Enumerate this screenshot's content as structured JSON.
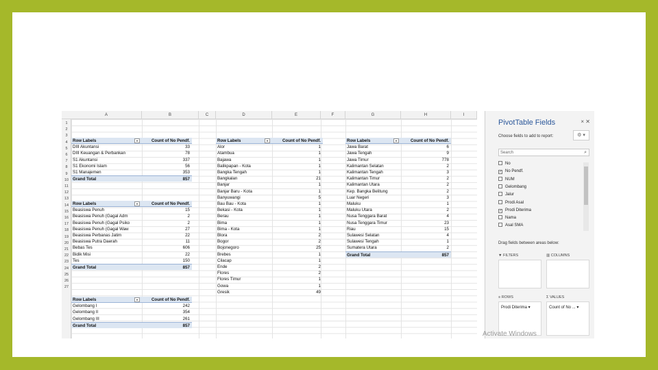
{
  "sheet": {
    "columns": [
      "A",
      "B",
      "C",
      "D",
      "E",
      "F",
      "G",
      "H",
      "I"
    ],
    "rows": [
      "1",
      "2",
      "3",
      "4",
      "5",
      "6",
      "7",
      "8",
      "9",
      "10",
      "11",
      "12",
      "13",
      "14",
      "15",
      "16",
      "17",
      "18",
      "19",
      "20",
      "21",
      "22",
      "23",
      "24",
      "25",
      "26",
      "27"
    ]
  },
  "pivot1": {
    "header": [
      "Row Labels",
      "Count of No Pendf."
    ],
    "rows": [
      [
        "DIII Akuntansi",
        "33"
      ],
      [
        "DIII Keuangan & Perbankan",
        "78"
      ],
      [
        "S1 Akuntansi",
        "337"
      ],
      [
        "S1 Ekonomi Islam",
        "56"
      ],
      [
        "S1 Manajemen",
        "353"
      ]
    ],
    "total": [
      "Grand Total",
      "857"
    ]
  },
  "pivot2": {
    "header": [
      "Row Labels",
      "Count of No Pendf."
    ],
    "rows": [
      [
        "Beasiswa Penuh",
        "15"
      ],
      [
        "Beasiswa Penuh (Gagal Adm",
        "2"
      ],
      [
        "Beasiswa Penuh (Gagal Psiko",
        "2"
      ],
      [
        "Beasiswa Penuh (Gagal Waw",
        "27"
      ],
      [
        "Beasiswa Perbanas Jatim",
        "22"
      ],
      [
        "Beasiswa Putra Daerah",
        "11"
      ],
      [
        "Bebas Tes",
        "606"
      ],
      [
        "Bidik Misi",
        "22"
      ],
      [
        "Tes",
        "150"
      ]
    ],
    "total": [
      "Grand Total",
      "857"
    ]
  },
  "pivot3": {
    "header": [
      "Row Labels",
      "Count of No Pendf."
    ],
    "rows": [
      [
        "Gelombang I",
        "242"
      ],
      [
        "Gelombang II",
        "354"
      ],
      [
        "Gelombang III",
        "261"
      ]
    ],
    "total": [
      "Grand Total",
      "857"
    ]
  },
  "pivot4": {
    "header": [
      "Row Labels",
      "Count of No Pendf."
    ],
    "rows": [
      [
        "Alor",
        "1"
      ],
      [
        "Atambua",
        "1"
      ],
      [
        "Bajawa",
        "1"
      ],
      [
        "Balikpapan - Kota",
        "1"
      ],
      [
        "Bangka Tengah",
        "1"
      ],
      [
        "Bangkalan",
        "21"
      ],
      [
        "Banjar",
        "1"
      ],
      [
        "Banjar Baru - Kota",
        "1"
      ],
      [
        "Banyuwangi",
        "5"
      ],
      [
        "Bau Bau - Kota",
        "1"
      ],
      [
        "Bekasi - Kota",
        "1"
      ],
      [
        "Berau",
        "1"
      ],
      [
        "Bima",
        "1"
      ],
      [
        "Bima - Kota",
        "1"
      ],
      [
        "Blora",
        "2"
      ],
      [
        "Bogor",
        "2"
      ],
      [
        "Bojonegoro",
        "25"
      ],
      [
        "Brebes",
        "1"
      ],
      [
        "Cilacap",
        "1"
      ],
      [
        "Ende",
        "2"
      ],
      [
        "Flores",
        "2"
      ],
      [
        "Flores Timur",
        "1"
      ],
      [
        "Gowa",
        "1"
      ],
      [
        "Gresik",
        "49"
      ]
    ]
  },
  "pivot5": {
    "header": [
      "Row Labels",
      "Count of No Pendf."
    ],
    "rows": [
      [
        "Jawa Barat",
        "6"
      ],
      [
        "Jawa Tengah",
        "9"
      ],
      [
        "Jawa Timur",
        "778"
      ],
      [
        "Kalimantan Selatan",
        "2"
      ],
      [
        "Kalimantan Tengah",
        "3"
      ],
      [
        "Kalimantan Timur",
        "2"
      ],
      [
        "Kalimantan Utara",
        "2"
      ],
      [
        "Kep. Bangka Belitung",
        "2"
      ],
      [
        "Luar Negeri",
        "3"
      ],
      [
        "Maluku",
        "1"
      ],
      [
        "Maluku Utara",
        "2"
      ],
      [
        "Nusa Tenggara Barat",
        "4"
      ],
      [
        "Nusa Tenggara Timur",
        "23"
      ],
      [
        "Riau",
        "15"
      ],
      [
        "Sulawesi Selatan",
        "4"
      ],
      [
        "Sulawesi Tengah",
        "1"
      ],
      [
        "Sumatera Utara",
        "2"
      ]
    ],
    "total": [
      "Grand Total",
      "857"
    ]
  },
  "pane": {
    "title": "PivotTable Fields",
    "close": "× ✕",
    "subtitle": "Choose fields to add to report:",
    "gear": "⚙ ▾",
    "search_placeholder": "Search",
    "fields": [
      {
        "label": "No",
        "checked": false
      },
      {
        "label": "No Pendf.",
        "checked": true
      },
      {
        "label": "NUM",
        "checked": false
      },
      {
        "label": "Gelombang",
        "checked": false
      },
      {
        "label": "Jalur",
        "checked": false
      },
      {
        "label": "Prodi Asal",
        "checked": false
      },
      {
        "label": "Prodi Diterima",
        "checked": true
      },
      {
        "label": "Nama",
        "checked": false
      },
      {
        "label": "Asal SMA",
        "checked": false
      }
    ],
    "drag_note": "Drag fields between areas below:",
    "areas": {
      "filters": "FILTERS",
      "columns": "COLUMNS",
      "rows": "ROWS",
      "values": "VALUES",
      "rows_item": "Prodi Diterima ▾",
      "values_item": "Count of No ... ▾"
    }
  },
  "watermark": "Activate Windows"
}
